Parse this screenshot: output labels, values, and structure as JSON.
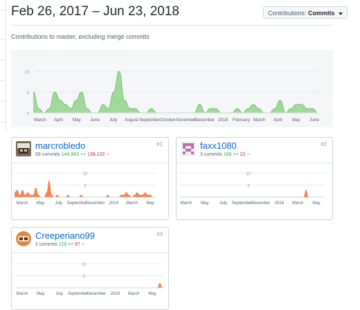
{
  "header": {
    "title": "Feb 26, 2017 – Jun 23, 2018",
    "contributions_prefix": "Contributions:",
    "contributions_value": "Commits"
  },
  "subtitle": "Contributions to master, excluding merge commits",
  "colors": {
    "main_fill": "#a1d99b",
    "main_stroke": "#6cc668",
    "user_fill": "#f6844b",
    "link": "#0366d6",
    "additions": "#28a745",
    "deletions": "#cb2431"
  },
  "chart_data": [
    {
      "type": "area",
      "ylim": [
        0,
        10
      ],
      "yticks": [
        "10",
        "5",
        "0"
      ],
      "xticks": [
        "March",
        "April",
        "May",
        "June",
        "July",
        "August",
        "September",
        "October",
        "November",
        "December",
        "2018",
        "February",
        "March",
        "April",
        "May",
        "June"
      ],
      "weekly_commits": [
        5,
        1,
        0,
        1,
        5,
        3,
        2,
        1,
        3,
        5,
        1,
        0,
        0,
        2,
        1,
        5,
        10,
        3,
        1,
        1,
        0,
        0,
        1,
        0,
        0,
        0,
        0,
        0,
        0,
        0,
        0,
        2,
        0,
        1,
        1,
        0,
        0,
        0,
        1,
        0,
        1,
        2,
        1,
        0,
        0,
        1,
        3,
        0,
        1,
        2,
        2,
        1,
        1,
        0
      ]
    },
    {
      "type": "area",
      "ylim": [
        0,
        10
      ],
      "yticks": [
        "10",
        "5"
      ],
      "xticks": [
        "March",
        "May",
        "July",
        "September",
        "November",
        "2018",
        "March",
        "May"
      ],
      "weekly_commits": [
        2,
        3,
        1,
        3,
        1,
        2,
        1,
        1,
        4,
        1,
        0,
        0,
        2,
        7,
        1,
        0,
        1,
        0,
        0,
        0,
        1,
        0,
        0,
        0,
        0,
        1,
        0,
        0,
        0,
        0,
        0,
        0,
        0,
        0,
        0,
        1,
        0,
        0,
        0,
        0,
        1,
        1,
        2,
        1,
        0,
        1,
        2,
        1,
        1,
        2,
        1,
        1,
        0,
        0
      ]
    },
    {
      "type": "area",
      "ylim": [
        0,
        10
      ],
      "yticks": [
        "10",
        "5"
      ],
      "xticks": [
        "March",
        "May",
        "July",
        "September",
        "November",
        "2018",
        "March",
        "May"
      ],
      "weekly_commits": [
        0,
        0,
        0,
        0,
        0,
        0,
        0,
        0,
        0,
        0,
        0,
        0,
        0,
        0,
        0,
        0,
        0,
        0,
        0,
        0,
        0,
        0,
        0,
        0,
        0,
        0,
        0,
        0,
        0,
        0,
        0,
        0,
        0,
        0,
        0,
        0,
        0,
        0,
        0,
        0,
        0,
        0,
        0,
        0,
        0,
        0,
        3,
        0,
        0,
        0,
        0,
        0,
        0,
        0
      ]
    },
    {
      "type": "area",
      "ylim": [
        0,
        10
      ],
      "yticks": [
        "10",
        "5"
      ],
      "xticks": [
        "March",
        "May",
        "July",
        "September",
        "November",
        "2018",
        "March",
        "May"
      ],
      "weekly_commits": [
        0,
        0,
        0,
        0,
        0,
        0,
        0,
        0,
        0,
        0,
        0,
        0,
        0,
        0,
        0,
        0,
        0,
        0,
        0,
        0,
        0,
        0,
        0,
        0,
        0,
        0,
        0,
        0,
        0,
        0,
        0,
        0,
        0,
        0,
        0,
        0,
        0,
        0,
        0,
        0,
        0,
        0,
        0,
        0,
        0,
        0,
        0,
        0,
        0,
        0,
        0,
        0,
        2,
        0
      ]
    }
  ],
  "contributors": [
    {
      "rank": "#1",
      "name": "marcrobledo",
      "commits": "69 commits",
      "additions": "144,943 ++",
      "deletions": "138,102 --"
    },
    {
      "rank": "#2",
      "name": "faxx1080",
      "commits": "3 commits",
      "additions": "168 ++",
      "deletions": "22 --"
    },
    {
      "rank": "#3",
      "name": "Creeperiano99",
      "commits": "2 commits",
      "additions": "119 ++",
      "deletions": "87 --"
    }
  ]
}
